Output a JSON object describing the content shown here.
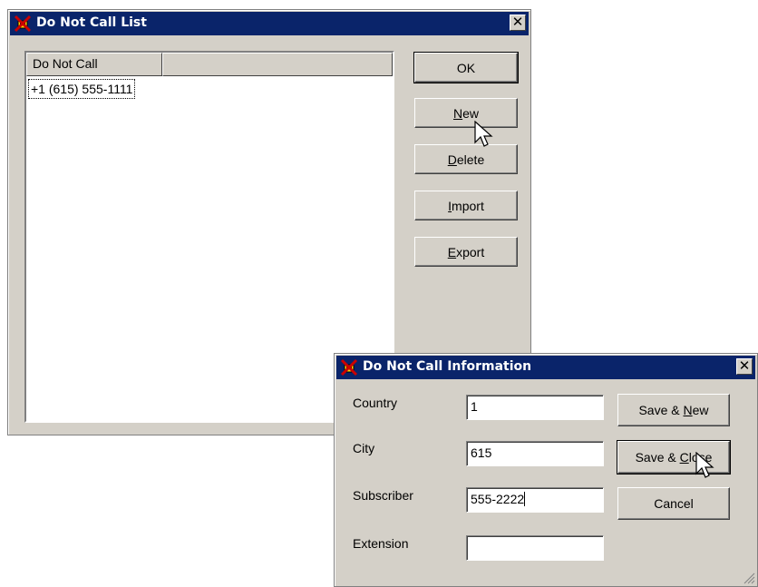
{
  "main_window": {
    "title": "Do Not Call List",
    "close_glyph": "✕",
    "list": {
      "column_header": "Do Not Call",
      "items": [
        "+1 (615) 555-1111"
      ]
    },
    "buttons": {
      "ok": {
        "label": "OK"
      },
      "new": {
        "mnemonic": "N",
        "rest": "ew"
      },
      "delete": {
        "mnemonic": "D",
        "rest": "elete"
      },
      "import": {
        "mnemonic": "I",
        "rest": "mport"
      },
      "export": {
        "mnemonic": "E",
        "rest": "xport"
      }
    }
  },
  "info_dialog": {
    "title": "Do Not Call Information",
    "close_glyph": "✕",
    "fields": {
      "country": {
        "label": "Country",
        "value": "1"
      },
      "city": {
        "label": "City",
        "value": "615"
      },
      "subscriber": {
        "label": "Subscriber",
        "value": "555-2222"
      },
      "extension": {
        "label": "Extension",
        "value": ""
      }
    },
    "buttons": {
      "save_new": {
        "prefix": "Save & ",
        "mnemonic": "N",
        "rest": "ew"
      },
      "save_close": {
        "prefix": "Save & ",
        "mnemonic": "C",
        "rest": "lose"
      },
      "cancel": {
        "label": "Cancel"
      }
    }
  },
  "icons": {
    "app_icon": "phone-prohibited-icon",
    "cursor": "arrow-pointer-icon"
  },
  "colors": {
    "titlebar": "#0a246a",
    "face": "#d4d0c8",
    "icon_red": "#cc0000",
    "icon_yellow": "#ffd200"
  }
}
